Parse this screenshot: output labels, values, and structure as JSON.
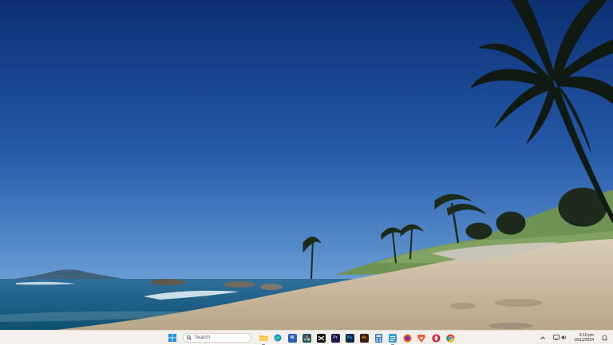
{
  "desktop": {
    "wallpaper": "tropical beach with palm trees under clear blue sky"
  },
  "taskbar": {
    "start": {
      "icon": "windows-logo-icon"
    },
    "search": {
      "label": "Search",
      "icon": "search-icon"
    },
    "apps": [
      {
        "name": "file-explorer",
        "icon": "folder-icon",
        "color": "#f2b632",
        "running": true
      },
      {
        "name": "edge",
        "icon": "edge-icon",
        "color": "#1b8fd6",
        "running": false
      },
      {
        "name": "word",
        "icon": "word-icon",
        "color": "#2b5fb8",
        "glyph": "W",
        "running": false
      },
      {
        "name": "davinci-resolve",
        "icon": "resolve-icon",
        "color": "#205a5a",
        "running": false
      },
      {
        "name": "capcut",
        "icon": "capcut-icon",
        "color": "#111111",
        "running": false
      },
      {
        "name": "premiere-pro",
        "icon": "premiere-icon",
        "color": "#1f1a4d",
        "glyph": "Pr",
        "running": false
      },
      {
        "name": "photoshop",
        "icon": "photoshop-icon",
        "color": "#0a2a4a",
        "glyph": "Ps",
        "running": false
      },
      {
        "name": "illustrator",
        "icon": "illustrator-icon",
        "color": "#3a1e05",
        "glyph": "Ai",
        "running": false
      },
      {
        "name": "calculator",
        "icon": "calculator-icon",
        "color": "#3a78c2",
        "running": false
      },
      {
        "name": "notepad",
        "icon": "notepad-icon",
        "color": "#35a0d8",
        "running": true
      },
      {
        "name": "firefox",
        "icon": "firefox-icon",
        "color": "#e66000",
        "running": false
      },
      {
        "name": "brave",
        "icon": "brave-icon",
        "color": "#fb542b",
        "running": false
      },
      {
        "name": "opera",
        "icon": "opera-icon",
        "color": "#e0112b",
        "running": false
      },
      {
        "name": "chrome",
        "icon": "chrome-icon",
        "color": "#34a853",
        "running": false
      }
    ],
    "tray": {
      "overflow_icon": "chevron-up-icon",
      "system_icons": [
        "wifi-icon",
        "volume-icon"
      ],
      "clock_time": "9:10 pm",
      "clock_date": "16/11/2024",
      "notification_icon": "notification-bell-icon"
    }
  }
}
